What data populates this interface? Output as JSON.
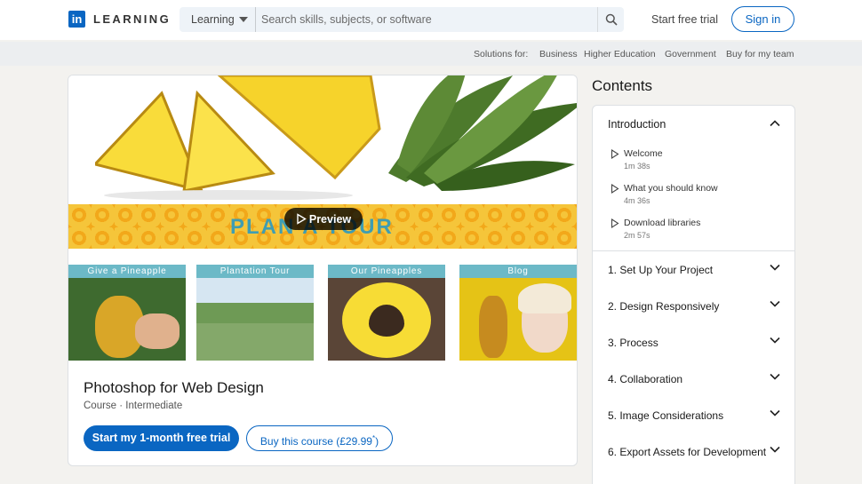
{
  "header": {
    "logo_letters": "in",
    "brand": "LEARNING",
    "search_category": "Learning",
    "search_placeholder": "Search skills, subjects, or software",
    "trial_link": "Start free trial",
    "signin": "Sign in"
  },
  "subnav": {
    "label": "Solutions for:",
    "items": [
      "Business",
      "Higher Education",
      "Government",
      "Buy for my team"
    ]
  },
  "course": {
    "hero_band_text": "PLAN A TOUR",
    "preview_label": "Preview",
    "tiles": [
      "Give a Pineapple",
      "Plantation Tour",
      "Our Pineapples",
      "Blog"
    ],
    "title": "Photoshop for Web Design",
    "meta": "Course  ·  Intermediate",
    "primary_button": "Start my 1-month free trial",
    "secondary_button": "Buy this course (£29.99",
    "price_note_mark": "*",
    "secondary_button_close": ")"
  },
  "contents": {
    "title": "Contents",
    "intro": {
      "label": "Introduction",
      "lessons": [
        {
          "title": "Welcome",
          "duration": "1m 38s"
        },
        {
          "title": "What you should know",
          "duration": "4m 36s"
        },
        {
          "title": "Download libraries",
          "duration": "2m 57s"
        }
      ]
    },
    "sections": [
      "1. Set Up Your Project",
      "2. Design Responsively",
      "3. Process",
      "4. Collaboration",
      "5. Image Considerations",
      "6. Export Assets for Development"
    ]
  },
  "colors": {
    "brand": "#0a66c2",
    "tile_label": "#6cb9c7",
    "band_text": "#3f9db2"
  }
}
